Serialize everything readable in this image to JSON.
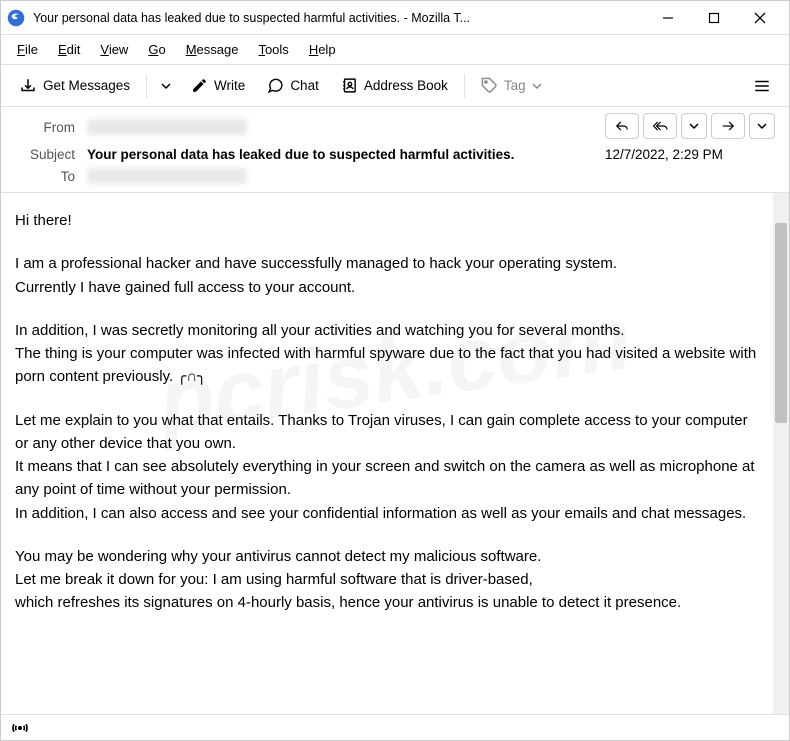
{
  "titlebar": {
    "title": "Your personal data has leaked due to suspected harmful activities. - Mozilla T..."
  },
  "menubar": {
    "file": "File",
    "edit": "Edit",
    "view": "View",
    "go": "Go",
    "message": "Message",
    "tools": "Tools",
    "help": "Help"
  },
  "toolbar": {
    "get_messages": "Get Messages",
    "write": "Write",
    "chat": "Chat",
    "address_book": "Address Book",
    "tag": "Tag"
  },
  "headers": {
    "from_label": "From",
    "from_value": "redacted@redacted",
    "subject_label": "Subject",
    "subject_value": "Your personal data has leaked due to suspected harmful activities.",
    "to_label": "To",
    "to_value": "redacted@redacted",
    "date": "12/7/2022, 2:29 PM"
  },
  "body": {
    "p1": "Hi there!",
    "p2": "I am a professional hacker and have successfully managed to hack your operating system.\nCurrently I have gained full access to your account.",
    "p3": "In addition, I was secretly monitoring all your activities and watching you for several months.\nThe thing is your computer was infected with harmful spyware due to the fact that you had visited a website with porn content previously. ╭∩╮",
    "p4": "Let me explain to you what that entails. Thanks to Trojan viruses, I can gain complete access to your computer or any other device that you own.\nIt means that I can see absolutely everything in your screen and switch on the camera as well as microphone at any point of time without your permission.\nIn addition, I can also access and see your confidential information as well as your emails and chat messages.",
    "p5": "You may be wondering why your antivirus cannot detect my malicious software.\nLet me break it down for you: I am using harmful software that is driver-based,\nwhich refreshes its signatures on 4-hourly basis, hence your antivirus is unable to detect it presence."
  },
  "watermark": "pcrisk.com"
}
